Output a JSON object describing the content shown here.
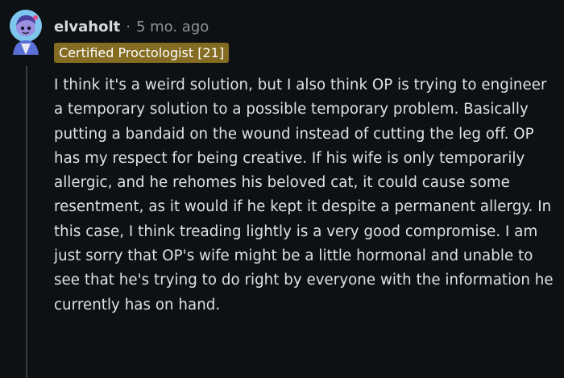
{
  "comment": {
    "author": "elvaholt",
    "separator": "·",
    "age": "5 mo. ago",
    "flair": "Certified Proctologist [21]",
    "body": "I think it's a weird solution, but I also think OP is trying to engineer a temporary solution to a possible temporary problem. Basically putting a bandaid on the wound instead of cutting the leg off. OP has my respect for being creative. If his wife is only temporarily allergic, and he rehomes his beloved cat, it could cause some resentment, as it would if he kept it despite a permanent allergy. In this case, I think treading lightly is a very good compromise. I am just sorry that OP's wife might be a little hormonal and unable to see that he's trying to do right by everyone with the information he currently has on hand."
  },
  "avatar": {
    "icon": "snoo-avatar-icon",
    "colors": {
      "background": "#7fc6ef",
      "head": "#9b8fe0",
      "eyes": "#1a1a2e",
      "body": "#5a6fd8"
    }
  },
  "colors": {
    "page_background": "#0e1113",
    "username": "#d7dadc",
    "meta_text": "#8b9396",
    "flair_background": "#846c22",
    "flair_text": "#ffffff",
    "body_text": "#dfe2e4",
    "thread_line": "#3a3d40"
  }
}
